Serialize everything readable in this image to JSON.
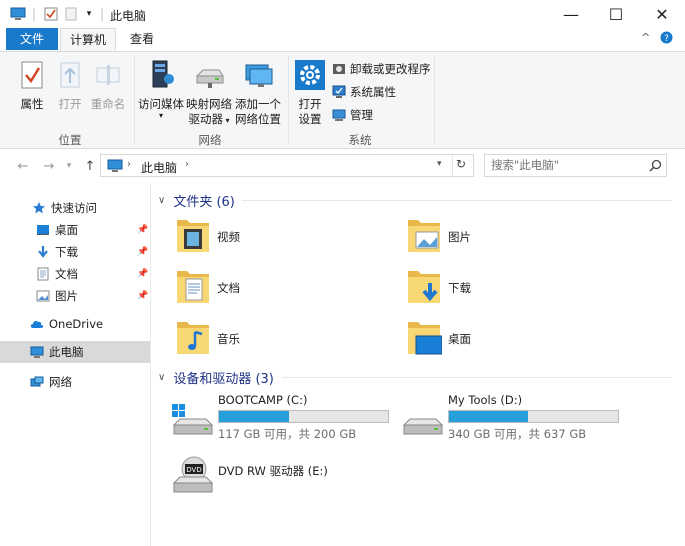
{
  "window": {
    "title": "此电脑",
    "controls": {
      "minimize": "—",
      "maximize": "☐",
      "close": "✕"
    }
  },
  "tabs": {
    "file": "文件",
    "computer": "计算机",
    "view": "查看"
  },
  "ribbon": {
    "location_group": {
      "label": "位置",
      "properties": "属性",
      "open": "打开",
      "rename": "重命名"
    },
    "network_group": {
      "label": "网络",
      "access_media_l1": "访问媒体",
      "map_drive_l1": "映射网络",
      "map_drive_l2": "驱动器",
      "add_location_l1": "添加一个",
      "add_location_l2": "网络位置"
    },
    "system_group": {
      "label": "系统",
      "open_settings_l1": "打开",
      "open_settings_l2": "设置",
      "uninstall": "卸载或更改程序",
      "system_properties": "系统属性",
      "manage": "管理"
    }
  },
  "address": {
    "path": "此电脑",
    "search_placeholder": "搜索\"此电脑\""
  },
  "nav": {
    "quick_access": "快速访问",
    "desktop": "桌面",
    "downloads": "下载",
    "documents": "文档",
    "pictures": "图片",
    "onedrive": "OneDrive",
    "this_pc": "此电脑",
    "network": "网络"
  },
  "folders_section": {
    "title": "文件夹 (6)",
    "items": [
      {
        "name": "视频"
      },
      {
        "name": "图片"
      },
      {
        "name": "文档"
      },
      {
        "name": "下载"
      },
      {
        "name": "音乐"
      },
      {
        "name": "桌面"
      }
    ]
  },
  "devices_section": {
    "title": "设备和驱动器 (3)",
    "drives": [
      {
        "name": "BOOTCAMP (C:)",
        "info": "117 GB 可用，共 200 GB",
        "used_fraction": 0.415
      },
      {
        "name": "My Tools (D:)",
        "info": "340 GB 可用，共 637 GB",
        "used_fraction": 0.466
      },
      {
        "name": "DVD RW 驱动器 (E:)"
      }
    ]
  },
  "colors": {
    "accent": "#1979ca",
    "drive_bar": "#26a0da",
    "section_title": "#1e3287",
    "folder": "#f8d775"
  }
}
